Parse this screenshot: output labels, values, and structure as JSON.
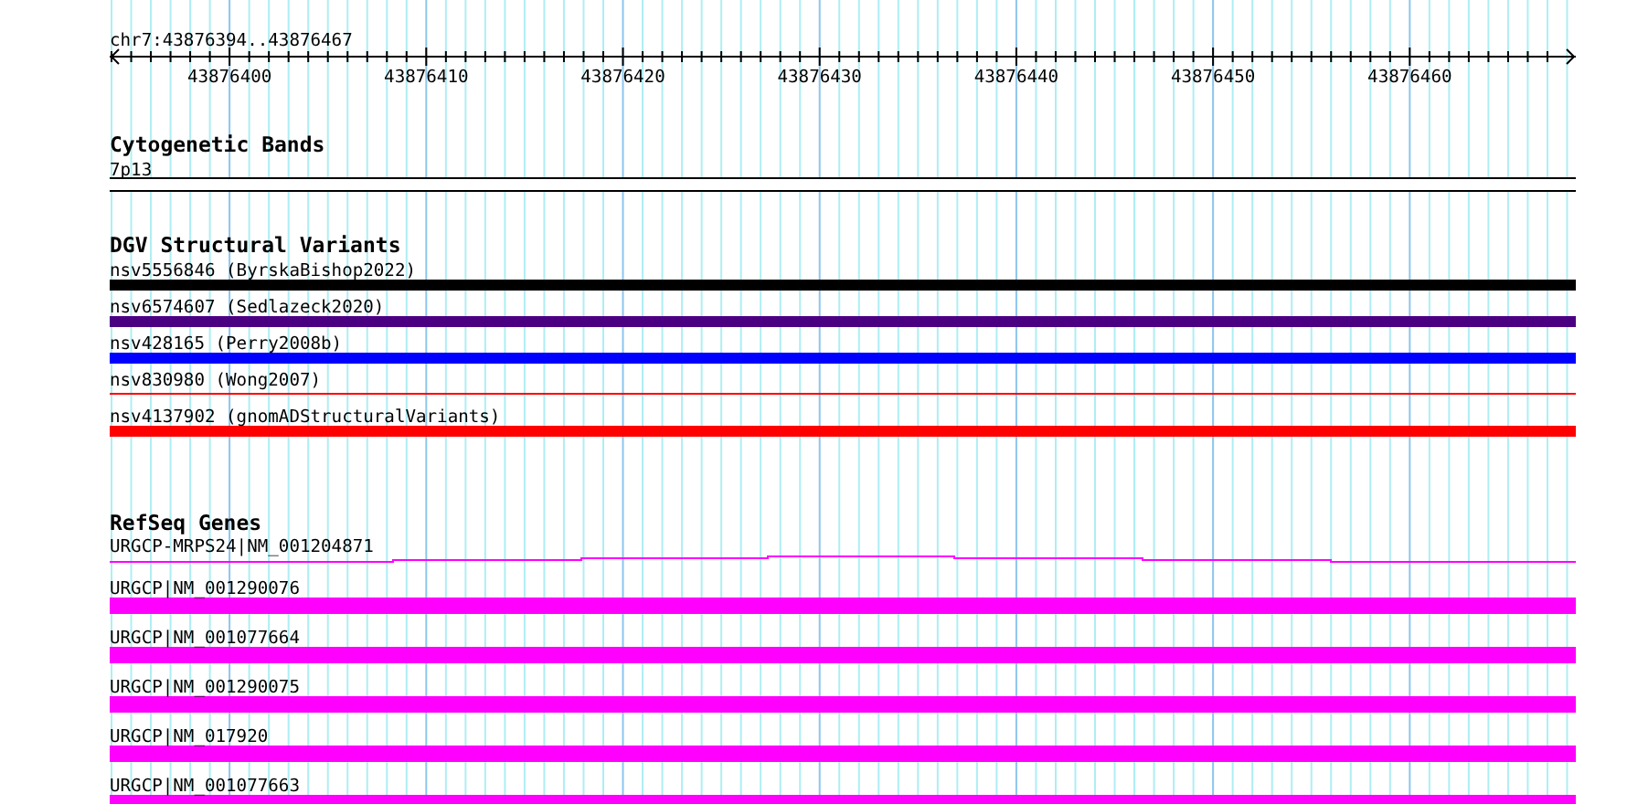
{
  "ruler": {
    "label": "chr7:43876394..43876467",
    "ticks": [
      "43876400",
      "43876410",
      "43876420",
      "43876430",
      "43876440",
      "43876450",
      "43876460"
    ]
  },
  "tracks": [
    {
      "title": "Cytogenetic Bands",
      "features": [
        {
          "label": "7p13",
          "kind": "band",
          "color": "#ffffff"
        }
      ]
    },
    {
      "title": "DGV Structural Variants",
      "features": [
        {
          "label": "nsv5556846 (ByrskaBishop2022)",
          "kind": "thick",
          "color": "#000000"
        },
        {
          "label": "nsv6574607 (Sedlazeck2020)",
          "kind": "thick",
          "color": "#4b0082"
        },
        {
          "label": "nsv428165 (Perry2008b)",
          "kind": "thick",
          "color": "#0000ff"
        },
        {
          "label": "nsv830980 (Wong2007)",
          "kind": "thin",
          "color": "#ff0000"
        },
        {
          "label": "nsv4137902 (gnomADStructuralVariants)",
          "kind": "thick",
          "color": "#ff0000"
        }
      ]
    },
    {
      "title": "RefSeq Genes",
      "features": [
        {
          "label": "URGCP-MRPS24|NM_001204871",
          "kind": "intron",
          "color": "#ff00ff"
        },
        {
          "label": "URGCP|NM_001290076",
          "kind": "exon",
          "color": "#ff00ff"
        },
        {
          "label": "URGCP|NM_001077664",
          "kind": "exon",
          "color": "#ff00ff"
        },
        {
          "label": "URGCP|NM_001290075",
          "kind": "exon",
          "color": "#ff00ff"
        },
        {
          "label": "URGCP|NM_017920",
          "kind": "exon",
          "color": "#ff00ff"
        },
        {
          "label": "URGCP|NM_001077663",
          "kind": "exon",
          "color": "#ff00ff"
        }
      ]
    }
  ]
}
